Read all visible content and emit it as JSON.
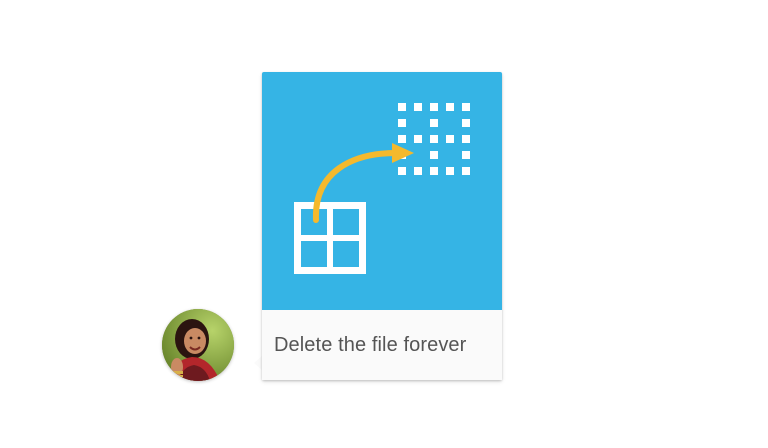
{
  "message": {
    "caption": "Delete the file forever",
    "sender_avatar": "person-avatar",
    "illustration_icon": "grid-move-icon"
  },
  "colors": {
    "illustration_bg": "#35b4e5",
    "arrow": "#f4b92d",
    "grid": "#ffffff",
    "caption_text": "#555555"
  }
}
